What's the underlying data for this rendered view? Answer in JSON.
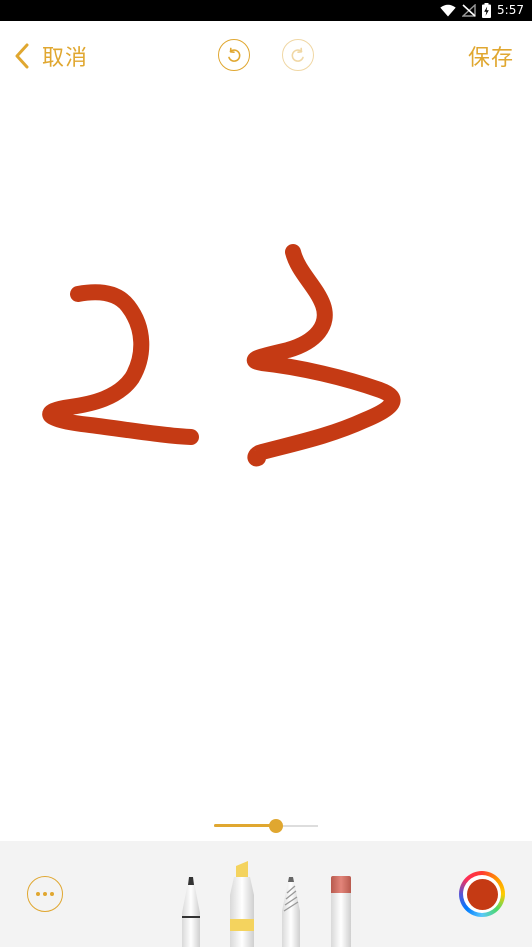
{
  "status_bar": {
    "time": "5:57",
    "icons": [
      "wifi-icon",
      "no-signal-icon",
      "battery-charging-icon"
    ]
  },
  "top_bar": {
    "cancel_label": "取消",
    "save_label": "保存",
    "icons": [
      "chevron-left-icon",
      "undo-icon",
      "redo-icon"
    ]
  },
  "stroke_width": {
    "value_fraction": 0.6
  },
  "toolbar": {
    "tools": [
      "pen",
      "marker",
      "pencil",
      "eraser"
    ],
    "icons": [
      "more-icon",
      "color-picker-icon"
    ],
    "selected_color": "#c53a14"
  },
  "colors": {
    "accent": "#e0a730",
    "ink": "#c53a14"
  }
}
